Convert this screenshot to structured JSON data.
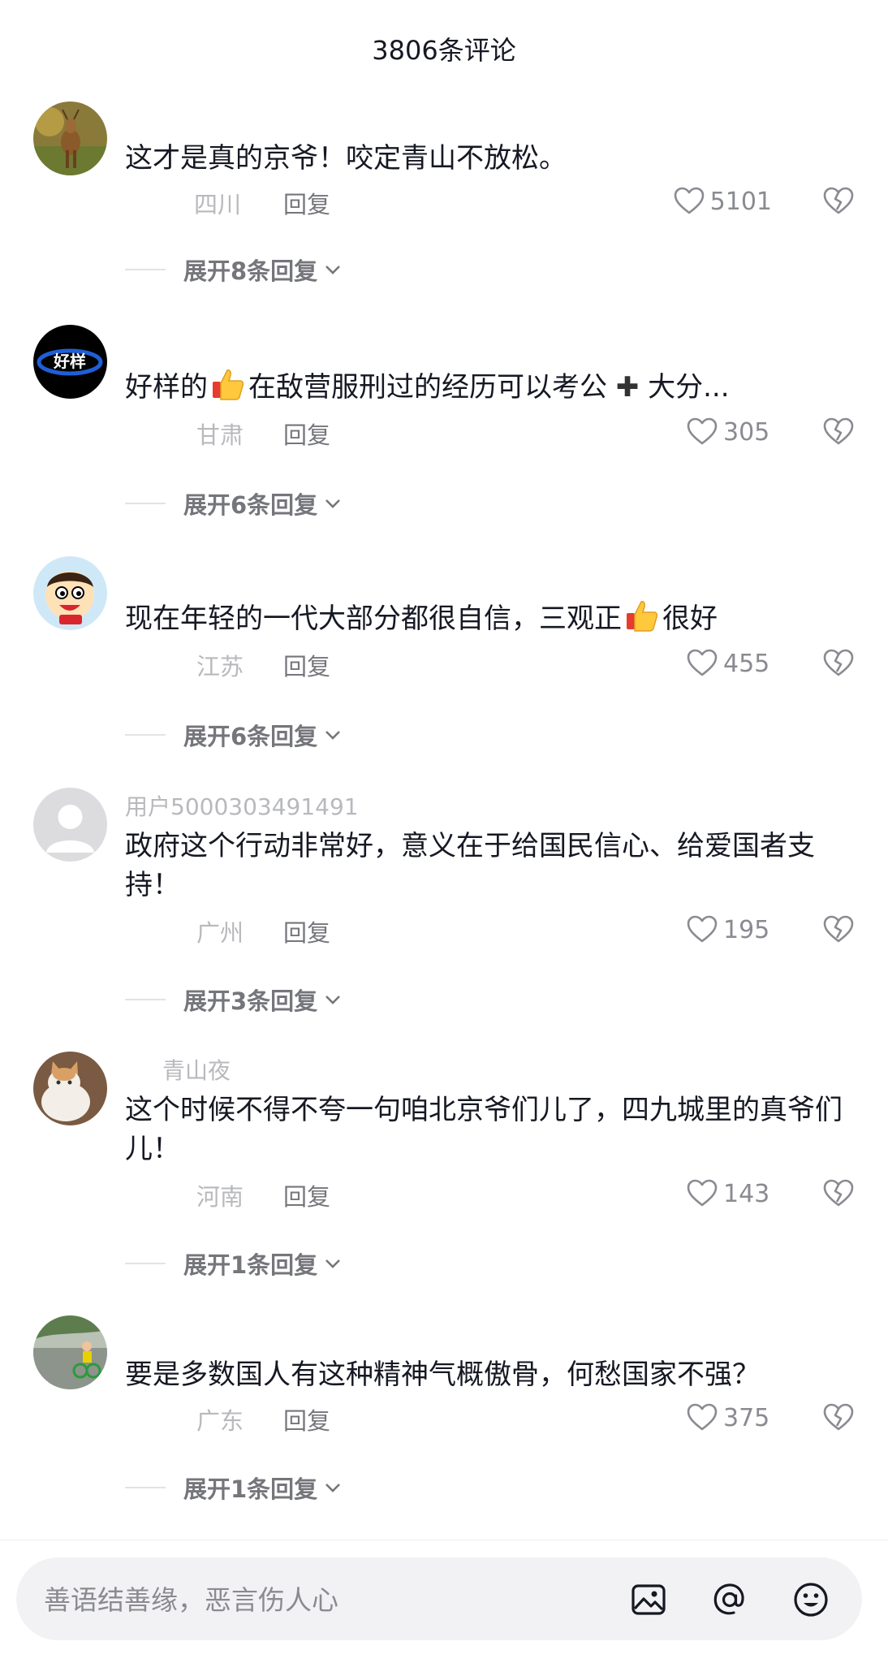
{
  "header": {
    "title": "3806条评论"
  },
  "comments": [
    {
      "username": "",
      "text_parts": [
        "这才是真的京爷！咬定青山不放松。"
      ],
      "location": "四川",
      "reply_label": "回复",
      "likes": "5101",
      "expand_label": "展开8条回复",
      "avatar": "deer-photo"
    },
    {
      "username": "",
      "text_parts": [
        "好样的",
        "在敌营服刑过的经历可以考公",
        "大分..."
      ],
      "location": "甘肃",
      "reply_label": "回复",
      "likes": "305",
      "expand_label": "展开6条回复",
      "avatar": "haoyang-logo",
      "avatar_text": "好样"
    },
    {
      "username": "",
      "text_parts": [
        "现在年轻的一代大部分都很自信，三观正",
        "很好"
      ],
      "location": "江苏",
      "reply_label": "回复",
      "likes": "455",
      "expand_label": "展开6条回复",
      "avatar": "cartoon-boy"
    },
    {
      "username": "用户5000303491491",
      "text_parts": [
        "政府这个行动非常好，意义在于给国民信心、给爱国者支持！"
      ],
      "location": "广州",
      "reply_label": "回复",
      "likes": "195",
      "expand_label": "展开3条回复",
      "avatar": "default-user"
    },
    {
      "username": "青山夜",
      "text_parts": [
        "这个时候不得不夸一句咱北京爷们儿了，四九城里的真爷们儿！"
      ],
      "location": "河南",
      "reply_label": "回复",
      "likes": "143",
      "expand_label": "展开1条回复",
      "avatar": "cat-photo"
    },
    {
      "username": "",
      "text_parts": [
        "要是多数国人有这种精神气概傲骨，何愁国家不强？"
      ],
      "location": "广东",
      "reply_label": "回复",
      "likes": "375",
      "expand_label": "展开1条回复",
      "avatar": "kid-bike-photo"
    }
  ],
  "input_bar": {
    "placeholder": "善语结善缘，恶言伤人心",
    "icons": [
      "image-icon",
      "at-icon",
      "emoji-icon"
    ]
  },
  "colors": {
    "text_primary": "#161823",
    "text_secondary": "#75767b",
    "text_muted": "#b8b9bd",
    "input_bg": "#f2f2f4"
  }
}
